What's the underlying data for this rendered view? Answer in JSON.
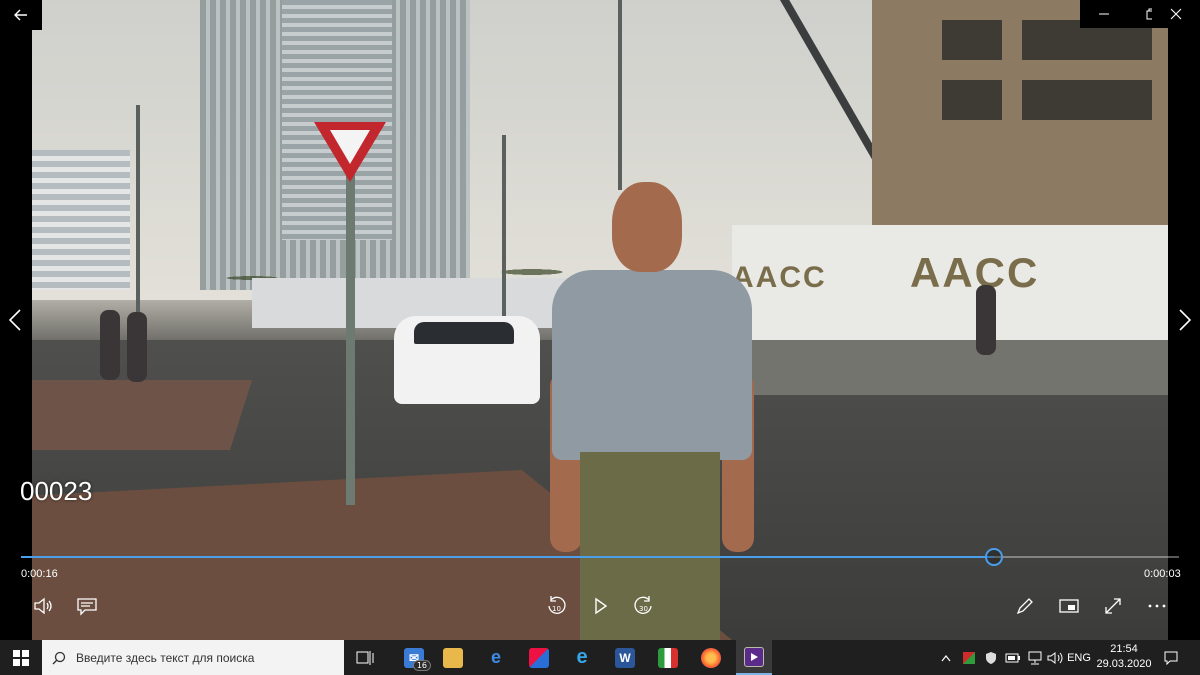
{
  "player": {
    "title": "00023",
    "time_elapsed": "0:00:16",
    "time_remaining": "0:00:03",
    "progress": 0.84,
    "accent_color": "#4a9eea"
  },
  "window_controls": {
    "back_icon": "back-arrow-icon",
    "minimize_icon": "minimize-icon",
    "restore_icon": "restore-icon",
    "close_icon": "close-icon"
  },
  "scene_text": {
    "wall_logo": "AACC"
  },
  "taskbar": {
    "search_placeholder": "Введите здесь текст для поиска",
    "mail_badge": "16",
    "language": "ENG",
    "time": "21:54",
    "date": "29.03.2020",
    "apps": [
      "task-view",
      "mail",
      "file-explorer",
      "edge",
      "ccleaner",
      "internet-explorer",
      "word",
      "photos",
      "firefox",
      "movies-tv"
    ]
  }
}
